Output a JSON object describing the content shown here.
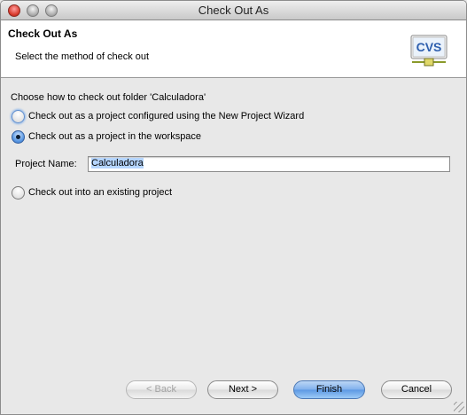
{
  "window": {
    "title": "Check Out As"
  },
  "banner": {
    "title": "Check Out As",
    "description": "Select the method of check out",
    "logo_text": "CVS"
  },
  "content": {
    "prompt": "Choose how to check out folder 'Calculadora'",
    "options": [
      {
        "label": "Check out as a project configured using the New Project Wizard",
        "checked": false
      },
      {
        "label": "Check out as a project in the workspace",
        "checked": true
      },
      {
        "label": "Check out into an existing project",
        "checked": false
      }
    ],
    "project_name": {
      "label": "Project Name:",
      "value": "Calculadora"
    }
  },
  "buttons": {
    "back": "< Back",
    "next": "Next >",
    "finish": "Finish",
    "cancel": "Cancel"
  },
  "colors": {
    "accent": "#5c98e3",
    "selection": "#b5d5ff"
  }
}
